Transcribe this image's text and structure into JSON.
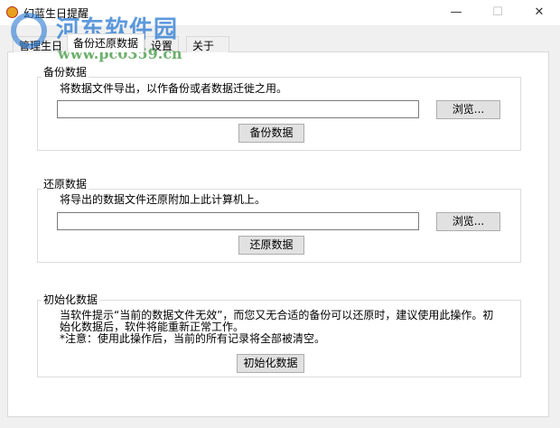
{
  "window": {
    "title": "幻蓝生日提醒",
    "minimize": "—",
    "maximize": "☐",
    "close": "✕"
  },
  "tabs": [
    {
      "label": "管理生日"
    },
    {
      "label": "备份还原数据",
      "active": true
    },
    {
      "label": "设置"
    },
    {
      "label": "关于"
    }
  ],
  "backup": {
    "title": "备份数据",
    "description": "将数据文件导出，以作备份或者数据迁徙之用。",
    "path_value": "",
    "browse_label": "浏览...",
    "action_label": "备份数据"
  },
  "restore": {
    "title": "还原数据",
    "description": "将导出的数据文件还原附加上此计算机上。",
    "path_value": "",
    "browse_label": "浏览...",
    "action_label": "还原数据"
  },
  "init": {
    "title": "初始化数据",
    "line1": "当软件提示“当前的数据文件无效”，而您又无合适的备份可以还原时，建议使用此操作。初",
    "line2": "始化数据后，软件将能重新正常工作。",
    "line3": "*注意：使用此操作后，当前的所有记录将全部被清空。",
    "action_label": "初始化数据"
  },
  "watermark": {
    "name": "河东软件园",
    "url": "www.pc0359.cn"
  }
}
